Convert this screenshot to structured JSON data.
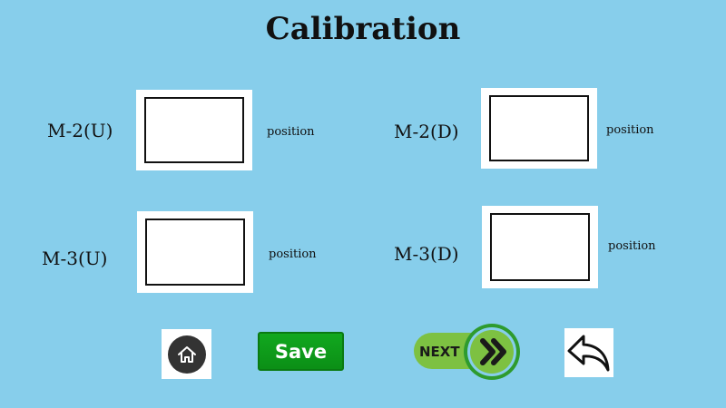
{
  "header": {
    "title": "Calibration"
  },
  "fields": {
    "m2u": {
      "label": "M-2(U)",
      "position_label": "position",
      "value": ""
    },
    "m2d": {
      "label": "M-2(D)",
      "position_label": "position",
      "value": ""
    },
    "m3u": {
      "label": "M-3(U)",
      "position_label": "position",
      "value": ""
    },
    "m3d": {
      "label": "M-3(D)",
      "position_label": "position",
      "value": ""
    }
  },
  "footer": {
    "home_icon": "home-icon",
    "save_label": "Save",
    "next_label": "NEXT",
    "next_icon": "double-chevron-right-icon",
    "back_icon": "undo-arrow-icon"
  },
  "colors": {
    "background": "#87ceeb",
    "save_green": "#0e9c1a",
    "next_green": "#7dc142",
    "next_ring": "#2e9b2e"
  }
}
